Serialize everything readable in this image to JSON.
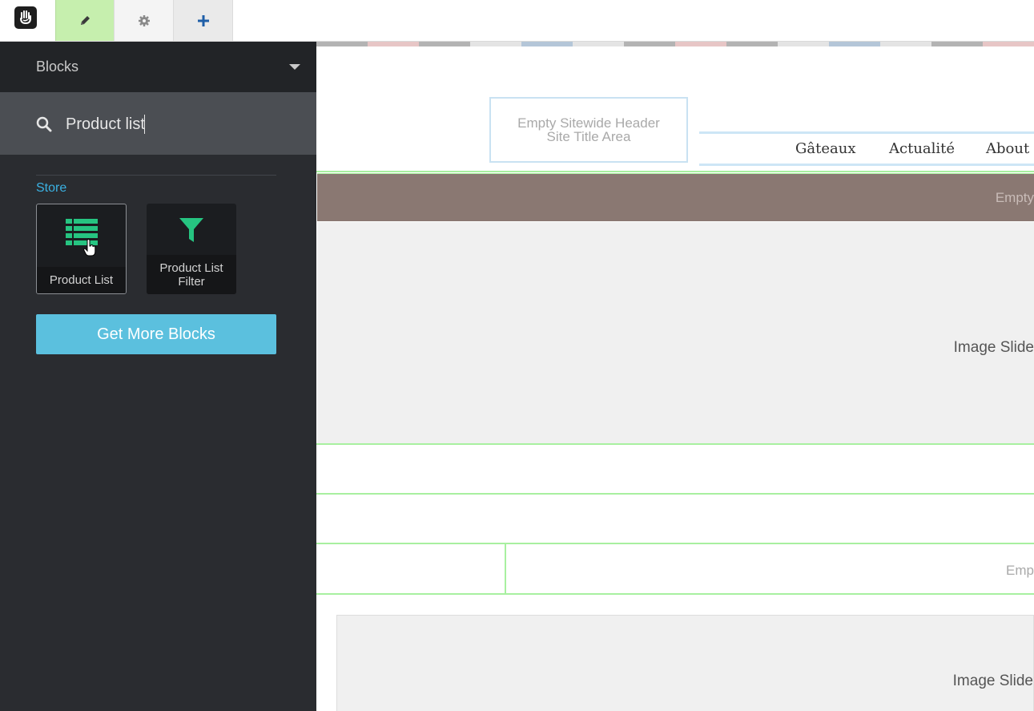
{
  "toolbar": {
    "logo_icon": "concrete5-hand-logo-icon",
    "edit_icon": "pencil-icon",
    "settings_icon": "gear-icon",
    "add_icon": "plus-icon",
    "edit_active_color": "#c6efae"
  },
  "panel": {
    "title": "Blocks",
    "search": {
      "value": "Product list",
      "placeholder": ""
    },
    "section": "Store",
    "blocks": [
      {
        "label": "Product List",
        "icon": "list-icon"
      },
      {
        "label": "Product List Filter",
        "icon": "filter-icon"
      }
    ],
    "get_more_label": "Get More Blocks",
    "accent_color": "#3bb1e2",
    "button_color": "#5bc0de",
    "icon_color": "#26c481"
  },
  "canvas": {
    "header_area": [
      "Empty Sitewide Header",
      "Site Title Area"
    ],
    "nav": [
      "Gâteaux",
      "Actualité",
      "About"
    ],
    "brown_band_text": "Empty",
    "slider1_text": "Image Slide",
    "emp_text": "Emp",
    "slider2_text": "Image Slide"
  }
}
